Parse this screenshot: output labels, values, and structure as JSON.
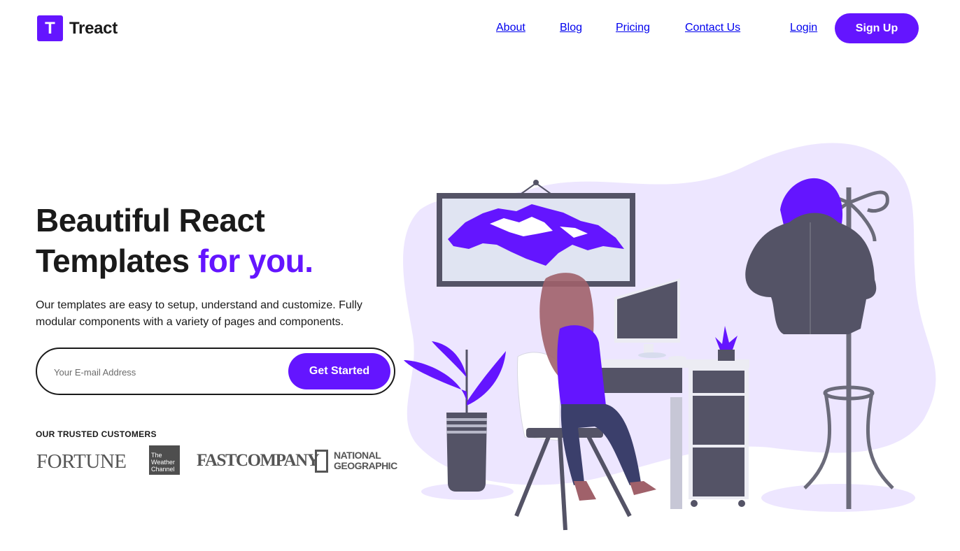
{
  "brand": {
    "logo_letter": "T",
    "name": "Treact"
  },
  "nav": {
    "links": [
      "About",
      "Blog",
      "Pricing",
      "Contact Us"
    ],
    "login": "Login",
    "signup": "Sign Up"
  },
  "hero": {
    "title_line1": "Beautiful React",
    "title_line2": "Templates",
    "title_accent": "for you.",
    "description": "Our templates are easy to setup, understand and customize. Fully modular components with a variety of pages and components.",
    "email_placeholder": "Your E-mail Address",
    "cta": "Get Started"
  },
  "customers": {
    "label": "OUR TRUSTED CUSTOMERS",
    "logos": {
      "fortune": "FORTUNE",
      "weather_line1": "The",
      "weather_line2": "Weather",
      "weather_line3": "Channel",
      "fast_company": "FASTCOMPANY",
      "natgeo_line1": "NATIONAL",
      "natgeo_line2": "GEOGRAPHIC"
    }
  },
  "colors": {
    "accent": "#6415ff",
    "dark": "#1a1a1a",
    "illustration_bg": "#ede6ff",
    "illustration_gray": "#545366"
  }
}
